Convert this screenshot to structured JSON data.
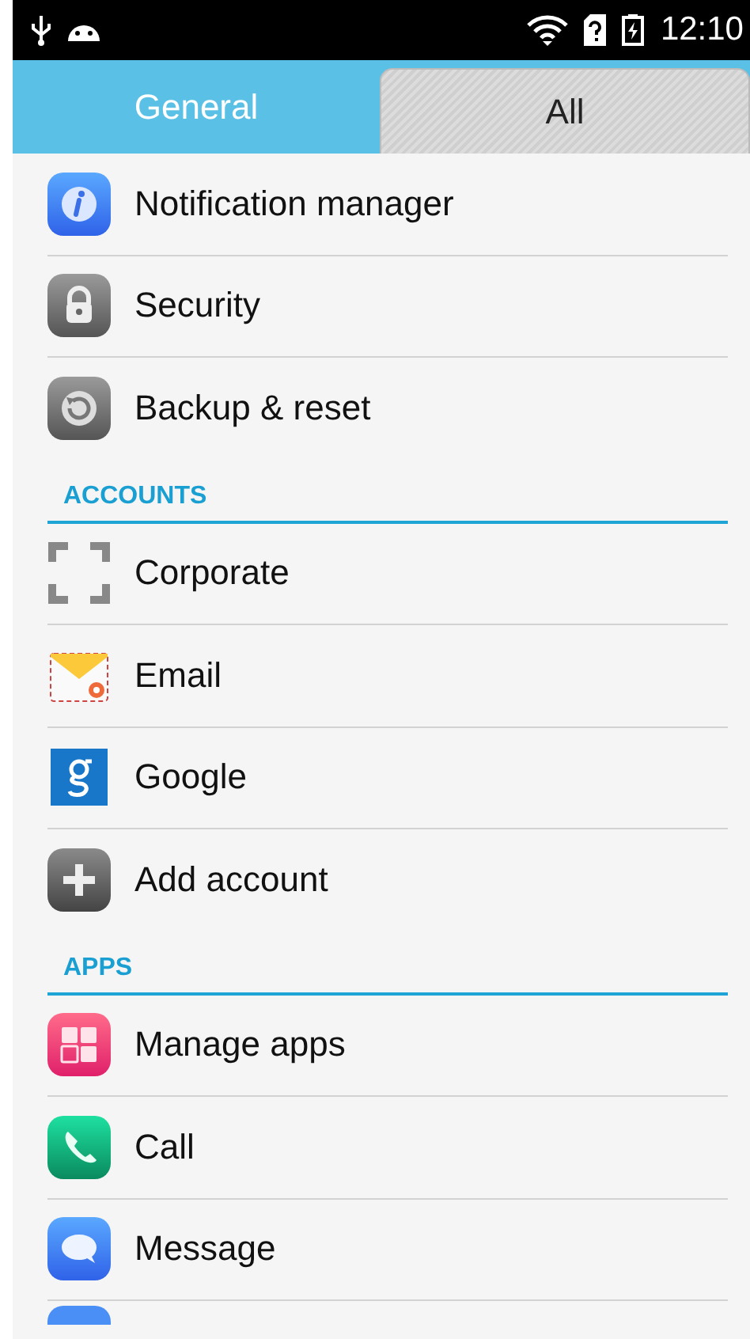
{
  "status_bar": {
    "time": "12:10"
  },
  "tabs": [
    {
      "label": "General",
      "selected": true
    },
    {
      "label": "All",
      "selected": false
    }
  ],
  "sections": [
    {
      "items": [
        {
          "kind": "info",
          "label": "Notification manager"
        },
        {
          "kind": "lock",
          "label": "Security"
        },
        {
          "kind": "restore",
          "label": "Backup & reset"
        }
      ]
    },
    {
      "header": "ACCOUNTS",
      "items": [
        {
          "kind": "corporate",
          "label": "Corporate"
        },
        {
          "kind": "email",
          "label": "Email"
        },
        {
          "kind": "google",
          "label": "Google"
        },
        {
          "kind": "add",
          "label": "Add account"
        }
      ]
    },
    {
      "header": "APPS",
      "items": [
        {
          "kind": "apps",
          "label": "Manage apps"
        },
        {
          "kind": "call",
          "label": "Call"
        },
        {
          "kind": "message",
          "label": "Message"
        }
      ]
    }
  ]
}
